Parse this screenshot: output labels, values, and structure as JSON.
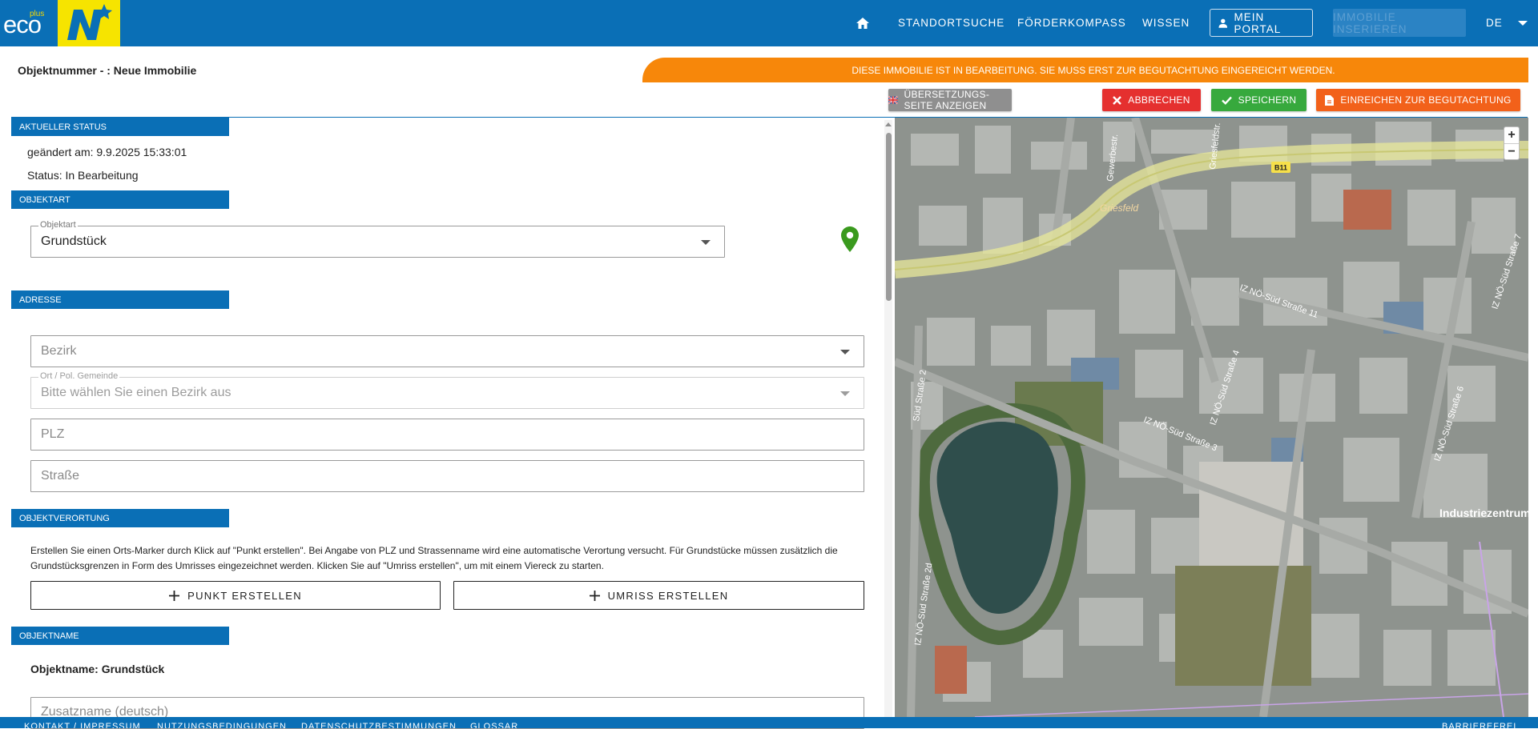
{
  "logo": {
    "brand_text": "eco",
    "brand_sup": "plus"
  },
  "nav": {
    "items": [
      "STANDORTSUCHE",
      "FÖRDERKOMPASS",
      "WISSEN"
    ],
    "portal": "MEIN PORTAL",
    "insert": "IMMOBILIE INSERIEREN",
    "lang": "DE"
  },
  "header": {
    "object_number": "Objektnummer - : Neue Immobilie",
    "banner": "DIESE IMMOBILIE IST IN BEARBEITUNG. SIE MUSS ERST ZUR BEGUTACHTUNG EINGEREICHT WERDEN.",
    "buttons": {
      "translate": "ÜBERSETZUNGS-SEITE ANZEIGEN",
      "cancel": "ABBRECHEN",
      "save": "SPEICHERN",
      "submit": "EINREICHEN ZUR BEGUTACHTUNG"
    }
  },
  "status": {
    "heading": "AKTUELLER STATUS",
    "changed": "geändert am: 9.9.2025 15:33:01",
    "state": "Status: In Bearbeitung"
  },
  "objektart": {
    "heading": "OBJEKTART",
    "legend": "Objektart",
    "value": "Grundstück"
  },
  "adresse": {
    "heading": "ADRESSE",
    "bezirk_placeholder": "Bezirk",
    "ort_legend": "Ort / Pol. Gemeinde",
    "ort_placeholder": "Bitte wählen Sie einen Bezirk aus",
    "plz_placeholder": "PLZ",
    "strasse_placeholder": "Straße"
  },
  "verortung": {
    "heading": "OBJEKTVERORTUNG",
    "help": "Erstellen Sie einen Orts-Marker durch Klick auf \"Punkt erstellen\". Bei Angabe von PLZ und Strassenname wird eine automatische Verortung versucht. Für Grundstücke müssen zusätzlich die Grundstücksgrenzen in Form des Umrisses eingezeichnet werden. Klicken Sie auf \"Umriss erstellen\", um mit einem Viereck zu starten.",
    "point_button": "PUNKT ERSTELLEN",
    "outline_button": "UMRISS ERSTELLEN"
  },
  "objektname": {
    "heading": "OBJEKTNAME",
    "title": "Objektname: Grundstück",
    "zusatz_placeholder": "Zusatzname (deutsch)"
  },
  "map": {
    "zoom_in": "+",
    "zoom_out": "−",
    "labels": {
      "griesfeld": "Griesfeld",
      "b11": "B11",
      "industriezentrum": "Industriezentrum-N",
      "str11": "IZ NÖ-Süd Straße 11",
      "str4": "IZ NÖ-Süd Straße 4",
      "str3": "IZ NÖ-Süd Straße 3",
      "str6": "IZ NÖ-Süd Straße 6",
      "str7": "IZ NÖ-Süd Straße 7",
      "str2": "Süd Straße 2",
      "str2d": "IZ NÖ-Süd Straße 2d",
      "gewerbe": "Gewerbestr.",
      "griesfeldstr": "Griesfeldstr."
    }
  },
  "footer": {
    "links": [
      "KONTAKT / IMPRESSUM",
      "NUTZUNGSBEDINGUNGEN",
      "DATENSCHUTZBESTIMMUNGEN",
      "GLOSSAR"
    ],
    "right": "BARRIEREFREI"
  },
  "colors": {
    "primary": "#0a6fb6",
    "banner": "#f7870a",
    "cancel": "#e5302f",
    "save": "#37a93d",
    "submit": "#f2611a",
    "translate": "#8f8f8f",
    "pin": "#3a9a1e"
  }
}
